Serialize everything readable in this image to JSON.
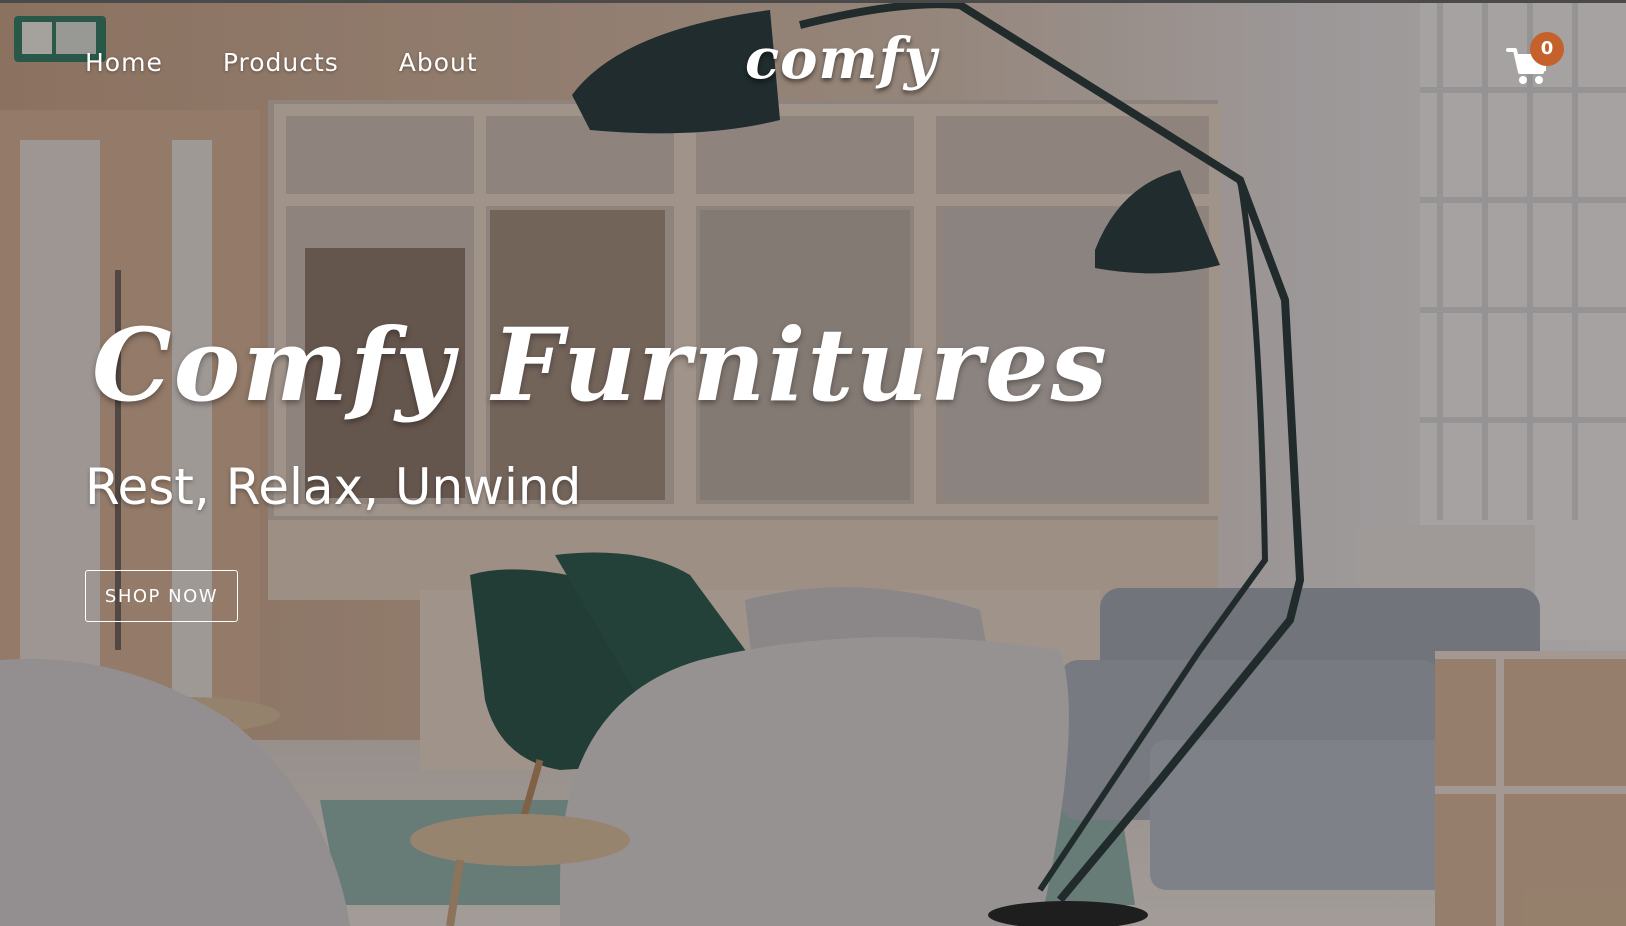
{
  "nav": {
    "links": [
      {
        "label": "Home"
      },
      {
        "label": "Products"
      },
      {
        "label": "About"
      }
    ],
    "logo": "comfy",
    "cart": {
      "icon": "cart-icon",
      "count": "0",
      "badge_color": "#c5612a"
    }
  },
  "hero": {
    "title": "Comfy Furnitures",
    "subtitle": "Rest, Relax, Unwind",
    "button_label": "SHOP NOW"
  }
}
